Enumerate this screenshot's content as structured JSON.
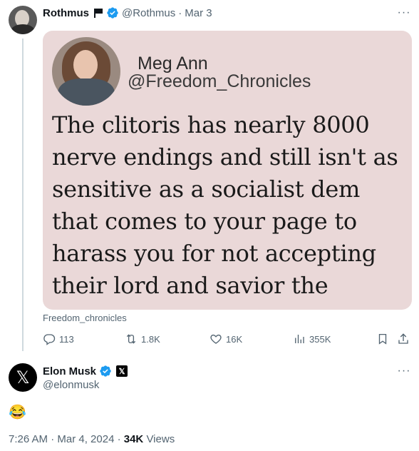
{
  "tweet": {
    "author_name": "Rothmus",
    "author_handle": "@Rothmus",
    "date_separator": "·",
    "date": "Mar 3",
    "embed": {
      "name": "Meg Ann",
      "handle": "@Freedom_Chronicles",
      "text": "The clitoris has nearly 8000 nerve endings and still isn't as sensitive as a socialist dem that comes to your page to harass you for not accepting their lord and savior the government."
    },
    "caption": "Freedom_chronicles",
    "actions": {
      "replies": "113",
      "reposts": "1.8K",
      "likes": "16K",
      "views": "355K"
    }
  },
  "reply": {
    "author_name": "Elon Musk",
    "author_handle": "@elonmusk",
    "text": "😂",
    "time": "7:26 AM · Mar 4, 2024 · ",
    "views_count": "34K",
    "views_label": " Views"
  },
  "colors": {
    "verified": "#1d9bf0",
    "secondary_text": "#536471",
    "embed_bg": "#ead8d8"
  },
  "icons": [
    "flag-icon",
    "verified-icon",
    "more-icon",
    "reply-icon",
    "repost-icon",
    "like-icon",
    "views-icon",
    "bookmark-icon",
    "share-icon",
    "x-logo-icon"
  ]
}
